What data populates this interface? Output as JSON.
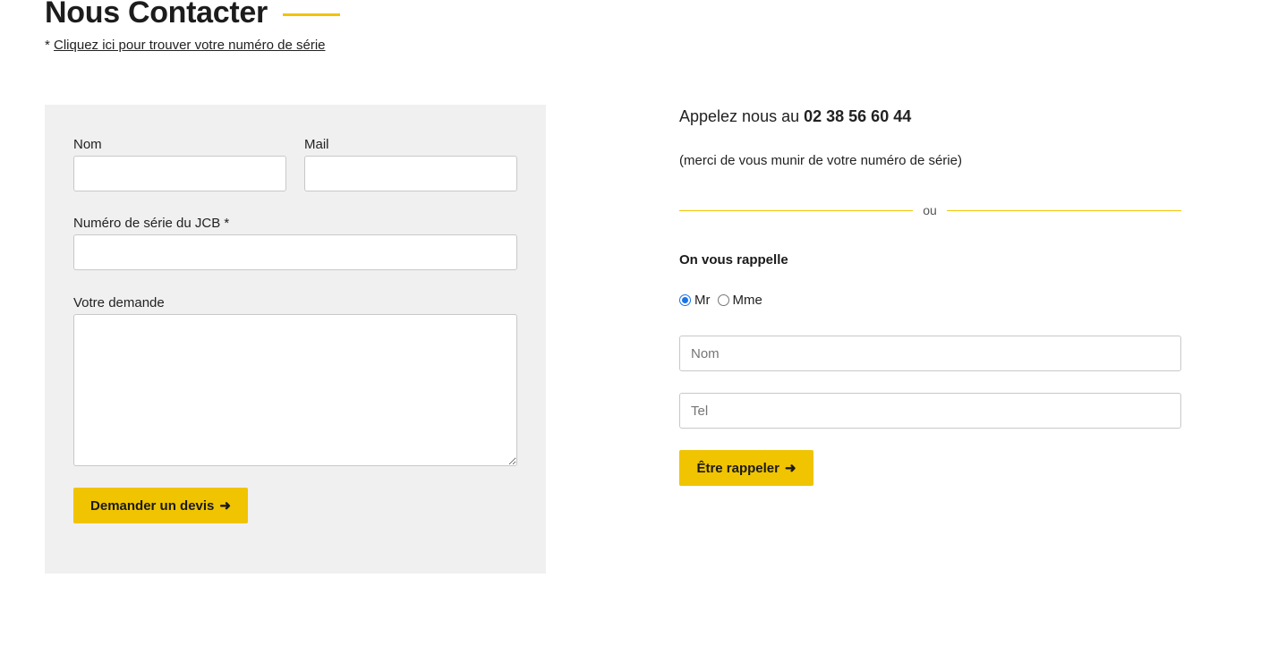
{
  "header": {
    "title": "Nous Contacter",
    "hint_prefix": "* ",
    "hint_link": "Cliquez ici pour trouver votre numéro de série"
  },
  "quote_form": {
    "nom_label": "Nom",
    "nom_value": "",
    "mail_label": "Mail",
    "mail_value": "",
    "serial_label": "Numéro de série du JCB *",
    "serial_value": "",
    "request_label": "Votre demande",
    "request_value": "",
    "submit_label": "Demander un devis",
    "submit_arrow": "➜"
  },
  "callback": {
    "call_prefix": "Appelez nous au ",
    "phone": "02 38 56 60 44",
    "note": "(merci de vous munir de votre numéro de série)",
    "separator": "ou",
    "title": "On vous rappelle",
    "civility_options": [
      "Mr",
      "Mme"
    ],
    "civility_selected": "Mr",
    "nom_placeholder": "Nom",
    "tel_placeholder": "Tel",
    "submit_label": "Être rappeler",
    "submit_arrow": "➜"
  },
  "colors": {
    "accent": "#f0c400",
    "panel_bg": "#f0f0f0",
    "radio_checked": "#1a73e8"
  }
}
